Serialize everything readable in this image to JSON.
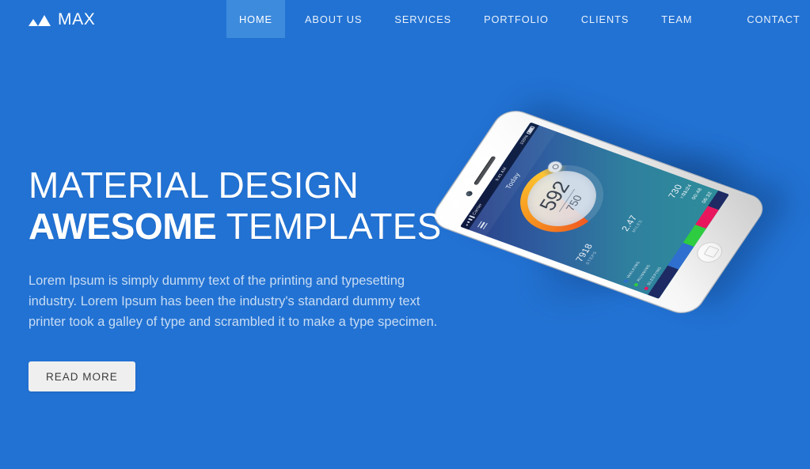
{
  "brand": {
    "logo_icon": "mountain-icon",
    "name": "MAX"
  },
  "nav": {
    "items": [
      {
        "label": "HOME",
        "active": true
      },
      {
        "label": "ABOUT US",
        "active": false
      },
      {
        "label": "SERVICES",
        "active": false
      },
      {
        "label": "PORTFOLIO",
        "active": false
      },
      {
        "label": "CLIENTS",
        "active": false
      },
      {
        "label": "TEAM",
        "active": false
      },
      {
        "label": "CONTACT",
        "active": false
      }
    ],
    "active_bg": "#3d8bdd"
  },
  "hero": {
    "headline_line1": "MATERIAL DESIGN",
    "headline_strong": "AWESOME",
    "headline_rest": " TEMPLATES",
    "paragraph": "Lorem Ipsum is simply dummy text of the printing and typesetting industry. Lorem Ipsum has been the industry's standard dummy text printer took a galley of type and scrambled it to make a type specimen.",
    "cta_label": "READ MORE",
    "background_color": "#2272d3",
    "headline_color": "#ffffff",
    "paragraph_color": "#c7dcf3",
    "cta_bg": "#efefef",
    "cta_text_color": "#3b3b3b"
  },
  "phone": {
    "device": "white-smartphone",
    "screen": {
      "statusbar": {
        "carrier": "Carrier",
        "clock": "9:41 AM",
        "battery_pct": "100%"
      },
      "appbar_title": "Today",
      "menu_icon": "hamburger-icon",
      "ring": {
        "value": "592",
        "goal": "750",
        "badge_icon": "target-icon",
        "progress_percent": 63,
        "color_start": "#f05a22",
        "color_end": "#fdc431"
      },
      "stats": [
        {
          "value": "7918",
          "label": "STEPS"
        },
        {
          "value": "2.47",
          "label": "MILES"
        },
        {
          "value": "730",
          "label": "KCAL"
        }
      ],
      "legend": [
        {
          "name": "WALKING",
          "time": "01:24",
          "color": "#2f6fd0"
        },
        {
          "name": "RUNNING",
          "time": "00:48",
          "color": "#2ecc40"
        },
        {
          "name": "SLEEPING",
          "time": "06:32",
          "color": "#e8175d"
        }
      ],
      "bar_segments": [
        {
          "color": "#1d2a63",
          "width": 28
        },
        {
          "color": "#2f6fd0",
          "width": 22
        },
        {
          "color": "#2ecc40",
          "width": 17
        },
        {
          "color": "#e8175d",
          "width": 18
        },
        {
          "color": "#1d2a63",
          "width": 15
        }
      ]
    }
  }
}
